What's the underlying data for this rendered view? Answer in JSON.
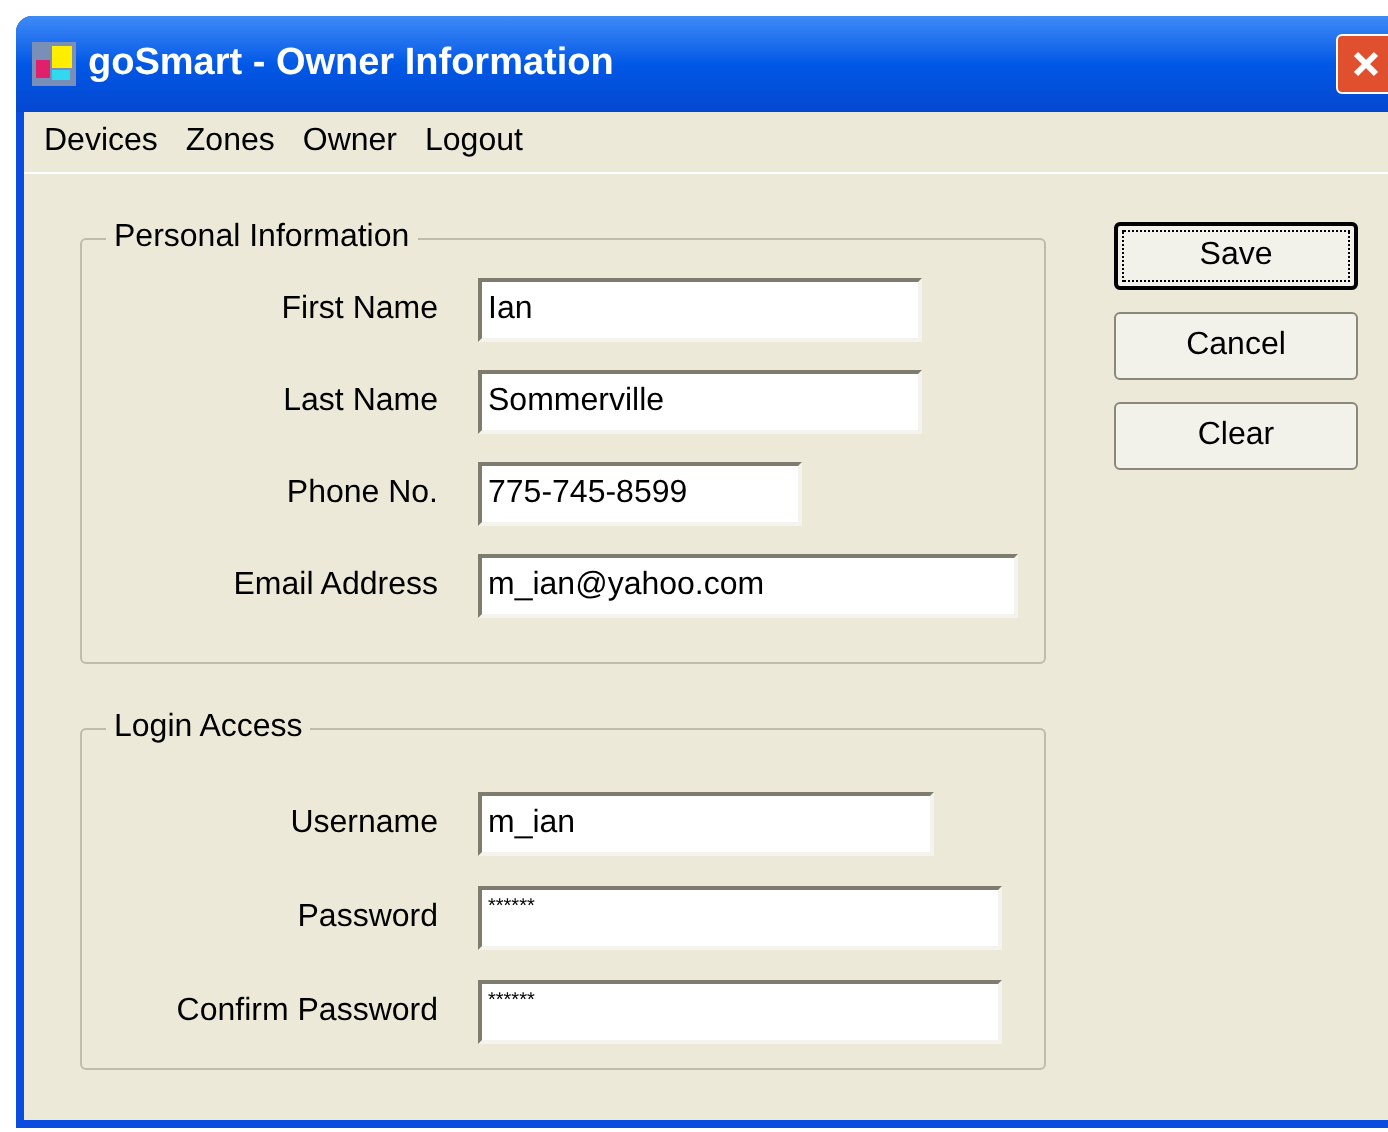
{
  "window": {
    "title": "goSmart - Owner Information"
  },
  "menu": [
    "Devices",
    "Zones",
    "Owner",
    "Logout"
  ],
  "groups": [
    {
      "title": "Personal Information",
      "fields": [
        {
          "label": "First Name",
          "value": "Ian",
          "kind": "text"
        },
        {
          "label": "Last Name",
          "value": "Sommerville",
          "kind": "text"
        },
        {
          "label": "Phone No.",
          "value": "775-745-8599",
          "kind": "text"
        },
        {
          "label": "Email Address",
          "value": "m_ian@yahoo.com",
          "kind": "text"
        }
      ]
    },
    {
      "title": "Login Access",
      "fields": [
        {
          "label": "Username",
          "value": "m_ian",
          "kind": "text"
        },
        {
          "label": "Password",
          "value": "******",
          "kind": "password"
        },
        {
          "label": "Confirm Password",
          "value": "******",
          "kind": "password"
        }
      ]
    }
  ],
  "buttons": [
    {
      "label": "Save",
      "focused": true
    },
    {
      "label": "Cancel",
      "focused": false
    },
    {
      "label": "Clear",
      "focused": false
    }
  ]
}
